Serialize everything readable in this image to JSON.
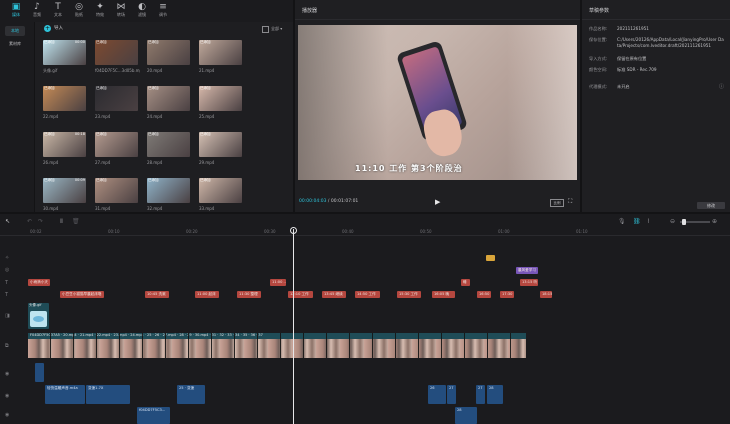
{
  "toolbar": {
    "tabs": [
      {
        "label": "媒体",
        "icon": "media-icon",
        "glyph": "▣"
      },
      {
        "label": "音频",
        "icon": "audio-icon",
        "glyph": "♪"
      },
      {
        "label": "文本",
        "icon": "text-icon",
        "glyph": "T"
      },
      {
        "label": "贴纸",
        "icon": "sticker-icon",
        "glyph": "◎"
      },
      {
        "label": "特效",
        "icon": "effects-icon",
        "glyph": "✦"
      },
      {
        "label": "转场",
        "icon": "transition-icon",
        "glyph": "⋈"
      },
      {
        "label": "滤镜",
        "icon": "filter-icon",
        "glyph": "◐"
      },
      {
        "label": "调节",
        "icon": "adjust-icon",
        "glyph": "≡"
      }
    ]
  },
  "media_nav": {
    "items": [
      "本地",
      "素材库"
    ]
  },
  "media": {
    "import_label": "导入",
    "sort_label": "全部",
    "thumbs": [
      {
        "name": "头像.gif",
        "badge": "已添加",
        "len": "00:00"
      },
      {
        "name": "f04DD7F5C...3d05b.mp4",
        "badge": "已添加",
        "len": ""
      },
      {
        "name": "20.mp4",
        "badge": "已添加",
        "len": ""
      },
      {
        "name": "21.mp4",
        "badge": "已添加",
        "len": ""
      },
      {
        "name": "22.mp4",
        "badge": "已添加",
        "len": ""
      },
      {
        "name": "23.mp4",
        "badge": "已添加",
        "len": ""
      },
      {
        "name": "24.mp4",
        "badge": "已添加",
        "len": ""
      },
      {
        "name": "25.mp4",
        "badge": "已添加",
        "len": ""
      },
      {
        "name": "26.mp4",
        "badge": "已添加",
        "len": "00:18"
      },
      {
        "name": "27.mp4",
        "badge": "已添加",
        "len": ""
      },
      {
        "name": "28.mp4",
        "badge": "已添加",
        "len": ""
      },
      {
        "name": "29.mp4",
        "badge": "已添加",
        "len": ""
      },
      {
        "name": "30.mp4",
        "badge": "已添加",
        "len": "00:09"
      },
      {
        "name": "31.mp4",
        "badge": "已添加",
        "len": ""
      },
      {
        "name": "32.mp4",
        "badge": "已添加",
        "len": ""
      },
      {
        "name": "33.mp4",
        "badge": "已添加",
        "len": ""
      },
      {
        "name": "34.mp4",
        "badge": "已添加",
        "len": ""
      },
      {
        "name": "35.mp4",
        "badge": "已添加",
        "len": ""
      },
      {
        "name": "36.mp4",
        "badge": "已添加",
        "len": ""
      },
      {
        "name": "37.mp4",
        "badge": "已添加",
        "len": ""
      }
    ]
  },
  "player": {
    "title": "播放器",
    "subtitle": "11:10 工作 第3个阶段治",
    "time_current": "00:00:04:03",
    "time_total": "00:01:07:01",
    "ratio_btn": "比例"
  },
  "props": {
    "title": "草稿参数",
    "rows": [
      {
        "label": "作品名称:",
        "value": "202111261951"
      },
      {
        "label": "保存位置:",
        "value": "C:/Users/20126/AppData/Local/JianyingPro/User Data/Projects/com.lveditor.draft/202111261951"
      },
      {
        "label": "导入方式:",
        "value": "保留在原有位置"
      },
      {
        "label": "颜色空间:",
        "value": "标准 SDR - Rec.709"
      },
      {
        "label": "代理模式:",
        "value": "未开启"
      }
    ],
    "edit_btn": "修改"
  },
  "ruler": [
    "00:02",
    "00:10",
    "00:20",
    "00:30",
    "00:40",
    "00:50",
    "01:00",
    "01:10"
  ],
  "timeline": {
    "text_clips_row1": [
      "小雨滴小天",
      "11:00 ...",
      "睡",
      "13:15 听"
    ],
    "text_clips_row2": [
      "小豆豆小猫猫早晨起床咯",
      "10:45 洗漱",
      "11:00 起床",
      "11:30 整理",
      "12:10 工作",
      "13:45 继续",
      "14:50 工作",
      "15:30 工作",
      "16:05 晚",
      "16:50",
      "17:30",
      "18:15"
    ],
    "sticker_clip": "晨风爱学习",
    "gif_clip": "头像.gif",
    "main_clips": "F04DD7F5C37A5 · 20.mp4 · 21.mp4 · 22.mp4 · 23.mp4 · 24.mp4 · 25 · 26 · 27.mp4 · 28 · 29 · 30.mp4 · 31 · 32 · 33 · 34 · 35 · 36 · 37",
    "audio_row1": [
      "轻快温暖声音.m4a",
      "变速1.7X",
      "25 · 变速",
      "26",
      "27",
      "27",
      "28"
    ],
    "audio_row2": [
      "f04DD7F5C3...",
      "28"
    ]
  }
}
